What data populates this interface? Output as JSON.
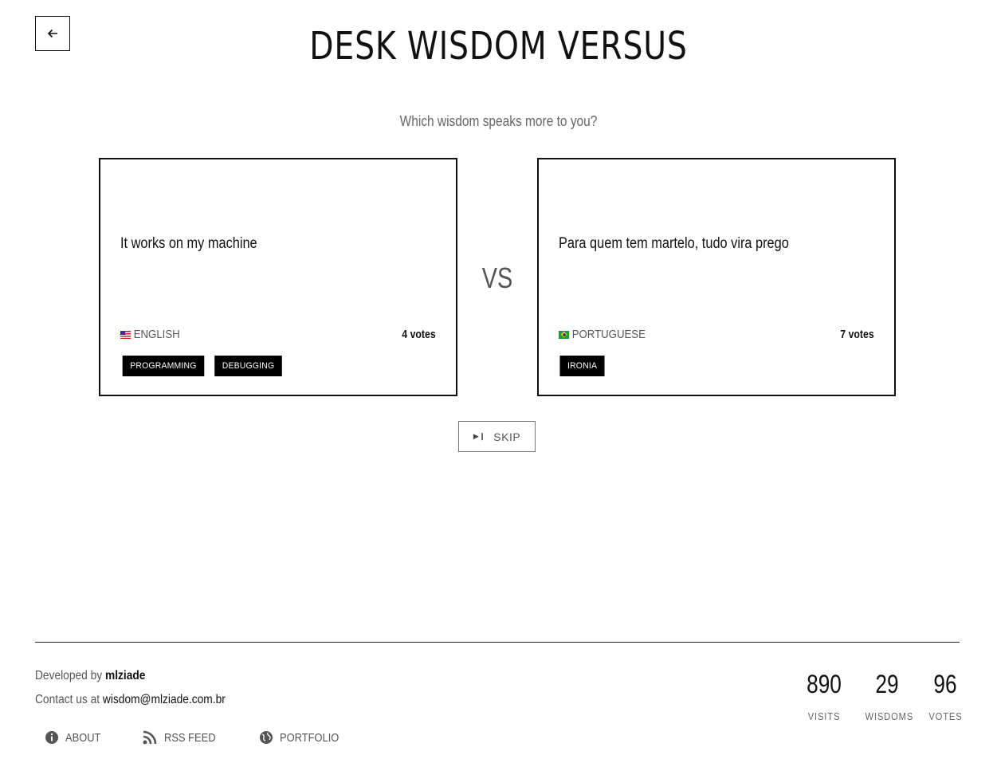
{
  "header": {
    "title": "DESK WISDOM VERSUS",
    "subtitle": "Which wisdom speaks more to you?"
  },
  "left_card": {
    "quote": "It works on my machine",
    "language": "ENGLISH",
    "flag": "us-flag",
    "votes": "4 votes",
    "tags": [
      "PROGRAMMING",
      "DEBUGGING"
    ]
  },
  "vs_label": "VS",
  "right_card": {
    "quote": "Para quem tem martelo, tudo vira prego",
    "language": "PORTUGUESE",
    "flag": "br-flag",
    "votes": "7 votes",
    "tags": [
      "IRONIA"
    ]
  },
  "skip": {
    "icon": "skip-next-icon",
    "label": "SKIP"
  },
  "footer": {
    "developed_prefix": "Developed by",
    "developer": "mlziade",
    "contact_prefix": "Contact us at",
    "email": "wisdom@mlziade.com.br",
    "links": [
      {
        "icon": "info-icon",
        "label": "ABOUT"
      },
      {
        "icon": "rss-icon",
        "label": "RSS FEED"
      },
      {
        "icon": "globe-icon",
        "label": "PORTFOLIO"
      }
    ],
    "stats": [
      {
        "value": "890",
        "label": "VISITS"
      },
      {
        "value": "29",
        "label": "WISDOMS"
      },
      {
        "value": "96",
        "label": "VOTES"
      }
    ]
  },
  "colors": {
    "text": "#111111",
    "muted": "#666666",
    "tag_bg": "#000000",
    "border": "#111111"
  }
}
